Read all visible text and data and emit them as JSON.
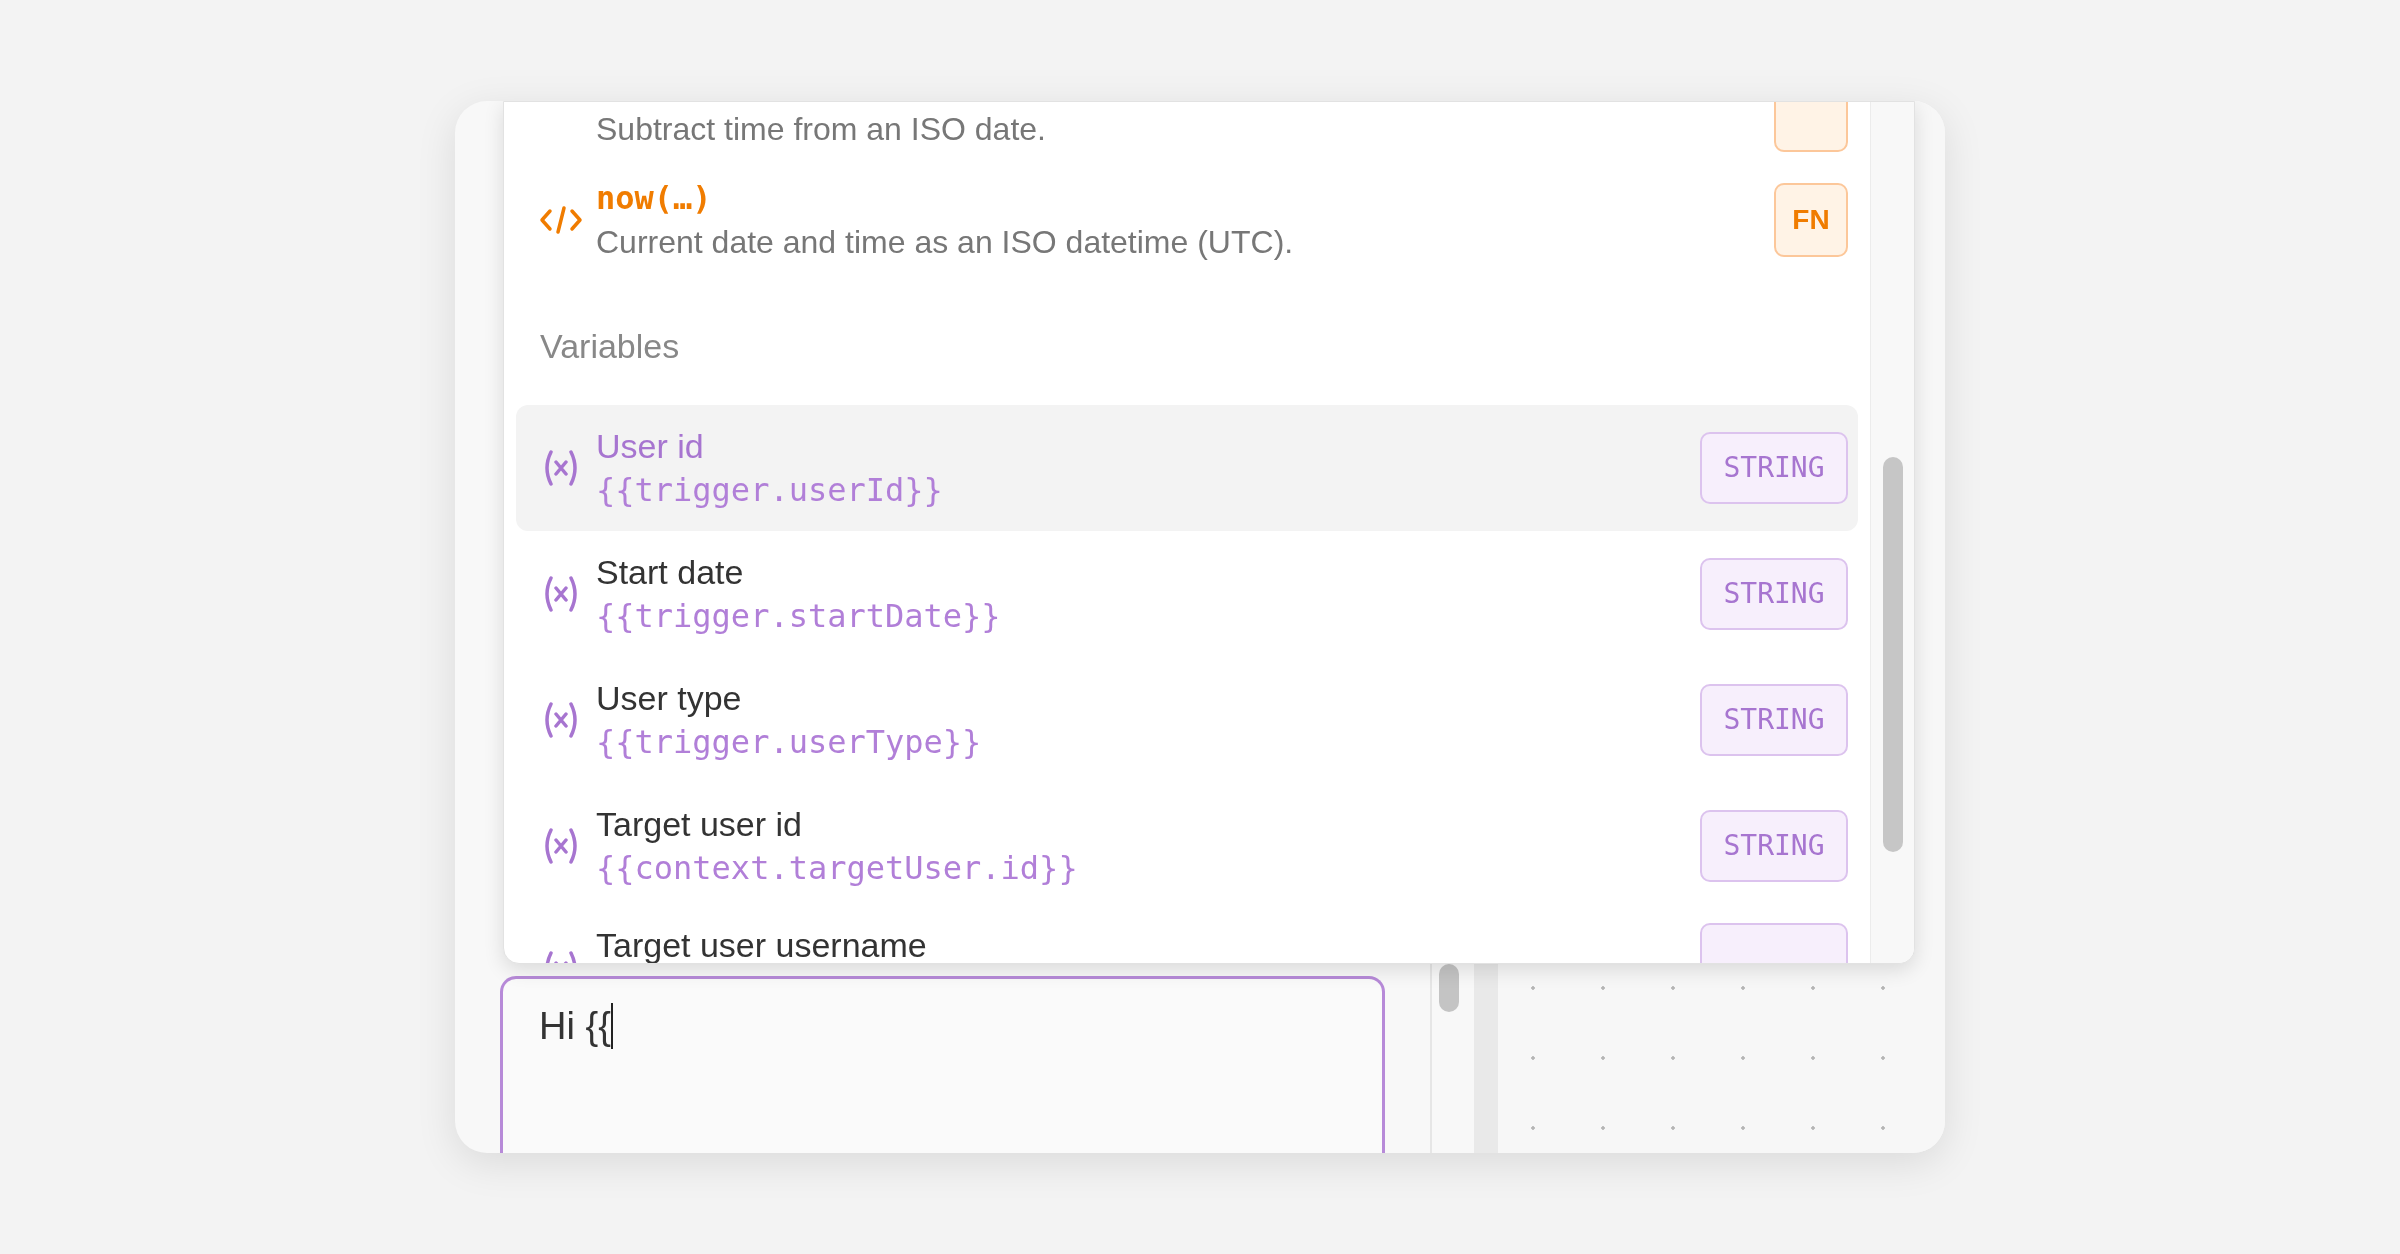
{
  "popup": {
    "partial_top": {
      "kind": "function",
      "description": "Subtract time from an ISO date."
    },
    "functions": [
      {
        "kind": "function",
        "name": "now(…)",
        "description": "Current date and time as an ISO datetime (UTC).",
        "badge": "FN"
      }
    ],
    "section": "Variables",
    "variables": [
      {
        "kind": "variable",
        "label": "User id",
        "path": "{{trigger.userId}}",
        "badge": "STRING",
        "selected": true
      },
      {
        "kind": "variable",
        "label": "Start date",
        "path": "{{trigger.startDate}}",
        "badge": "STRING",
        "selected": false
      },
      {
        "kind": "variable",
        "label": "User type",
        "path": "{{trigger.userType}}",
        "badge": "STRING",
        "selected": false
      },
      {
        "kind": "variable",
        "label": "Target user id",
        "path": "{{context.targetUser.id}}",
        "badge": "STRING",
        "selected": false
      }
    ],
    "partial_bottom": {
      "kind": "variable",
      "label": "Target user username"
    }
  },
  "editor": {
    "value": "Hi {{"
  }
}
